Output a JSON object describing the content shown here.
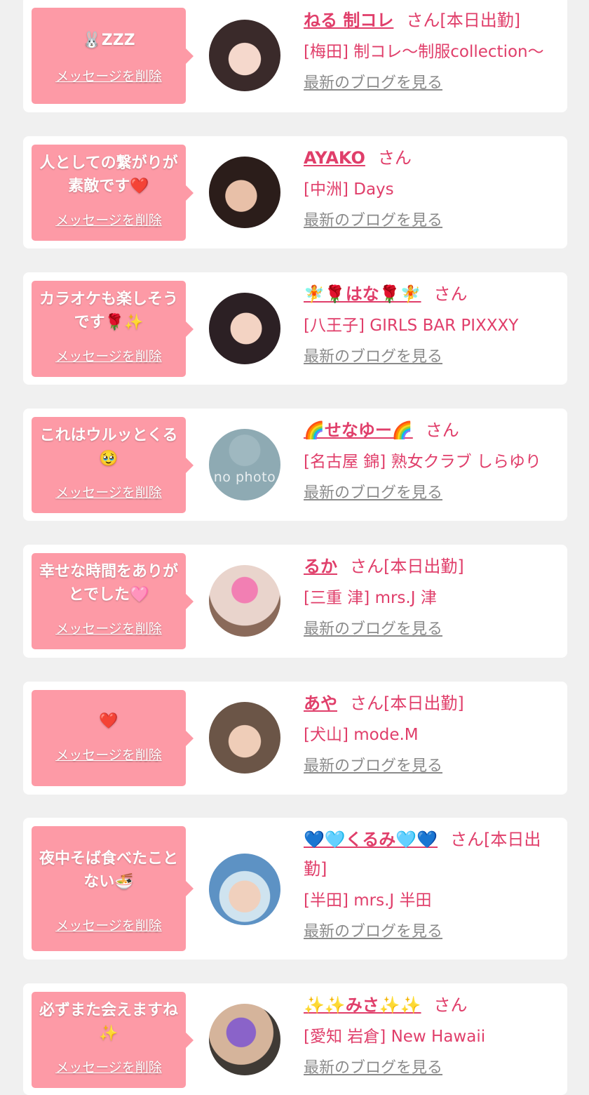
{
  "delete_label": "メッセージを削除",
  "blog_label": "最新のブログを見る",
  "colors": {
    "accent": "#e03e6a",
    "bubble": "#fd9aa6",
    "link_gray": "#8b8b8b"
  },
  "items": [
    {
      "message": "🐰ZZZ",
      "name": "ねる 制コレ",
      "suffix": "さん[本日出勤]",
      "shop": "[梅田] 制コレ〜制服collection〜",
      "avatar": "photo"
    },
    {
      "message": "人としての繋がりが素敵です❤️",
      "name": "AYAKO",
      "suffix": "さん",
      "shop": "[中洲] Days",
      "avatar": "photo"
    },
    {
      "message": "カラオケも楽しそうです🌹✨",
      "name": "🧚🌹はな🌹🧚",
      "suffix": "さん",
      "shop": "[八王子] GIRLS BAR PIXXXY",
      "avatar": "photo"
    },
    {
      "message": "これはウルッとくる🥹",
      "name": "🌈せなゆー🌈",
      "suffix": "さん",
      "shop": "[名古屋 錦] 熟女クラブ しらゆり",
      "avatar": "no-photo",
      "avatar_text": "no photo"
    },
    {
      "message": "幸せな時間をありがとでした🩷",
      "name": "るか",
      "suffix": "さん[本日出勤]",
      "shop": "[三重 津] mrs.J 津",
      "avatar": "photo"
    },
    {
      "message": "❤️",
      "name": "あや",
      "suffix": "さん[本日出勤]",
      "shop": "[犬山] mode.M",
      "avatar": "photo"
    },
    {
      "message": "夜中そば食べたことない🍜",
      "name": "💙🩵くるみ🩵💙",
      "suffix": "さん[本日出勤]",
      "shop": "[半田] mrs.J 半田",
      "avatar": "photo"
    },
    {
      "message": "必ずまた会えますね✨",
      "name": "✨✨みさ✨✨",
      "suffix": "さん",
      "shop": "[愛知 岩倉] New Hawaii",
      "avatar": "photo"
    }
  ]
}
